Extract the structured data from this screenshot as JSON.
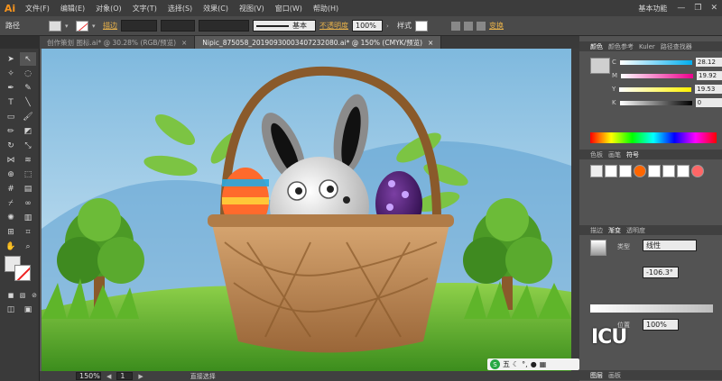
{
  "app": {
    "logo": "Ai",
    "workspace": "基本功能"
  },
  "menu": [
    "文件(F)",
    "编辑(E)",
    "对象(O)",
    "文字(T)",
    "选择(S)",
    "效果(C)",
    "视图(V)",
    "窗口(W)",
    "帮助(H)"
  ],
  "control": {
    "selection_label": "路径",
    "stroke_label": "描边",
    "stroke_style": "基本",
    "opacity_label": "不透明度",
    "opacity_value": "100%",
    "style_label": "样式",
    "transform_label": "变换"
  },
  "tabs": [
    {
      "label": "创作策划 图标.ai* @ 30.28% (RGB/预览)",
      "close": "×"
    },
    {
      "label": "Nipic_875058_20190930003407232080.ai* @ 150% (CMYK/预览)",
      "close": "×"
    }
  ],
  "status": {
    "zoom": "150%",
    "page": "1",
    "tool": "直接选择"
  },
  "color_panel": {
    "tabs": [
      "颜色",
      "颜色参考",
      "Kuler",
      "路径查找器"
    ],
    "channels": [
      {
        "name": "C",
        "value": "28.12",
        "color": "#00aeef"
      },
      {
        "name": "M",
        "value": "19.92",
        "color": "#ec008c"
      },
      {
        "name": "Y",
        "value": "19.53",
        "color": "#fff200"
      },
      {
        "name": "K",
        "value": "0",
        "color": "#000000"
      }
    ]
  },
  "swatch_panel": {
    "tabs": [
      "色板",
      "画笔",
      "符号"
    ]
  },
  "gradient_panel": {
    "tabs": [
      "描边",
      "渐变",
      "透明度"
    ],
    "type_label": "类型",
    "type_value": "线性",
    "angle_value": "-106.3°",
    "location_label": "位置",
    "location_value": "100%"
  },
  "bottom_tabs": [
    "图层",
    "画板"
  ],
  "watermark": "ICU",
  "ime": "五"
}
